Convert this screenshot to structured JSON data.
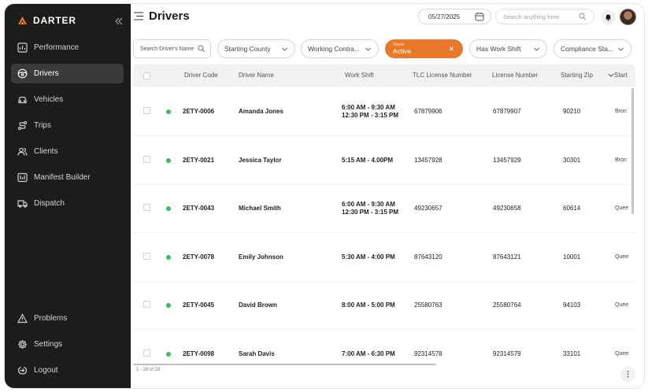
{
  "app": {
    "brand": "DARTER",
    "brand_color": "#e8782a",
    "collapse_icon": "double-chevron-left-icon"
  },
  "sidebar": {
    "items": [
      {
        "label": "Performance",
        "icon": "chart-icon",
        "active": false
      },
      {
        "label": "Drivers",
        "icon": "steering-wheel-icon",
        "active": true
      },
      {
        "label": "Vehicles",
        "icon": "car-icon",
        "active": false
      },
      {
        "label": "Trips",
        "icon": "route-icon",
        "active": false
      },
      {
        "label": "Clients",
        "icon": "users-icon",
        "active": false
      },
      {
        "label": "Manifest Builder",
        "icon": "manifest-icon",
        "active": false
      },
      {
        "label": "Dispatch",
        "icon": "truck-icon",
        "active": false
      }
    ],
    "bottom_items": [
      {
        "label": "Problems",
        "icon": "warning-icon"
      },
      {
        "label": "Settings",
        "icon": "gear-icon"
      },
      {
        "label": "Logout",
        "icon": "logout-icon"
      }
    ]
  },
  "header": {
    "title": "Drivers",
    "date": "05/27/2025",
    "search_placeholder": "Search anything here"
  },
  "filters": {
    "search_placeholder": "Search Driver's Name",
    "starting_county": "Starting County",
    "working_contract": "Working Contra...",
    "status_label": "Status",
    "status_value": "Active",
    "has_work_shift": "Has Work Shift",
    "compliance_status": "Compliance Sta..."
  },
  "table": {
    "columns": [
      "Driver Code",
      "Driver Name",
      "Work Shift",
      "TLC License Number",
      "License Number",
      "Starting Zip",
      "Start"
    ],
    "rows": [
      {
        "code": "2ETY-0006",
        "name": "Amanda Jones",
        "shift1": "6:00 AM - 9:30 AM",
        "shift2": "12:30 PM - 3:15 PM",
        "tlc": "67879906",
        "license": "67879907",
        "zip": "90210",
        "county": "Bron"
      },
      {
        "code": "2ETY-0021",
        "name": "Jessica Taylor",
        "shift1": "5:15 AM - 4.00PM",
        "shift2": "",
        "tlc": "13457928",
        "license": "13457929",
        "zip": "30301",
        "county": "Bron"
      },
      {
        "code": "2ETY-0043",
        "name": "Michael Smith",
        "shift1": "6:00 AM - 9:30 AM",
        "shift2": "12:30 PM - 3:15 PM",
        "tlc": "49230657",
        "license": "49230658",
        "zip": "60614",
        "county": "Quee"
      },
      {
        "code": "2ETY-0078",
        "name": "Emily Johnson",
        "shift1": "5:30 AM - 4:00 PM",
        "shift2": "",
        "tlc": "87643120",
        "license": "87643121",
        "zip": "10001",
        "county": "Quee"
      },
      {
        "code": "2ETY-0045",
        "name": "David Brown",
        "shift1": "8:00 AM - 5:00 PM",
        "shift2": "",
        "tlc": "25580763",
        "license": "25580764",
        "zip": "94103",
        "county": "Quee"
      },
      {
        "code": "2ETY-0098",
        "name": "Sarah Davis",
        "shift1": "7:00 AM - 6:30 PM",
        "shift2": "",
        "tlc": "92314578",
        "license": "92314579",
        "zip": "33101",
        "county": "Quee"
      }
    ],
    "status_color": "#3fb95a",
    "footer": "1 - 28 of 28"
  }
}
